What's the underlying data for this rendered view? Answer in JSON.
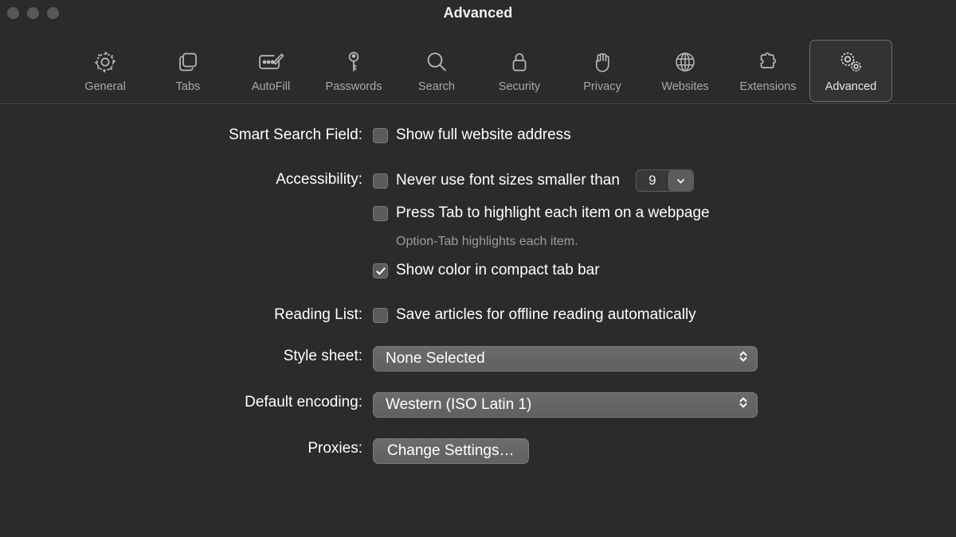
{
  "window": {
    "title": "Advanced",
    "traffic_lights": [
      "close-button",
      "minimize-button",
      "zoom-button"
    ]
  },
  "toolbar": {
    "tabs": [
      {
        "label": "General",
        "icon": "gear-icon",
        "selected": false
      },
      {
        "label": "Tabs",
        "icon": "tabs-icon",
        "selected": false
      },
      {
        "label": "AutoFill",
        "icon": "autofill-icon",
        "selected": false
      },
      {
        "label": "Passwords",
        "icon": "key-icon",
        "selected": false
      },
      {
        "label": "Search",
        "icon": "search-icon",
        "selected": false
      },
      {
        "label": "Security",
        "icon": "lock-icon",
        "selected": false
      },
      {
        "label": "Privacy",
        "icon": "hand-icon",
        "selected": false
      },
      {
        "label": "Websites",
        "icon": "globe-icon",
        "selected": false
      },
      {
        "label": "Extensions",
        "icon": "puzzle-icon",
        "selected": false
      },
      {
        "label": "Advanced",
        "icon": "double-gear-icon",
        "selected": true
      }
    ]
  },
  "settings": {
    "smart_search_field": {
      "label": "Smart Search Field:",
      "show_full_address": {
        "label": "Show full website address",
        "checked": false
      }
    },
    "accessibility": {
      "label": "Accessibility:",
      "min_font_size": {
        "label": "Never use font sizes smaller than",
        "checked": false,
        "value": "9"
      },
      "press_tab": {
        "label": "Press Tab to highlight each item on a webpage",
        "checked": false
      },
      "hint": "Option-Tab highlights each item.",
      "show_color_tab_bar": {
        "label": "Show color in compact tab bar",
        "checked": true
      }
    },
    "reading_list": {
      "label": "Reading List:",
      "save_offline": {
        "label": "Save articles for offline reading automatically",
        "checked": false
      }
    },
    "style_sheet": {
      "label": "Style sheet:",
      "value": "None Selected"
    },
    "default_encoding": {
      "label": "Default encoding:",
      "value": "Western (ISO Latin 1)"
    },
    "proxies": {
      "label": "Proxies:",
      "button_label": "Change Settings…"
    }
  },
  "colors": {
    "window_background": "#2b2b2b",
    "text_primary": "#ffffff",
    "text_secondary": "#9d9d9d",
    "tab_label": "#a9a9a9",
    "control_fill": "#636363",
    "selection_border": "#6e6e6e"
  }
}
